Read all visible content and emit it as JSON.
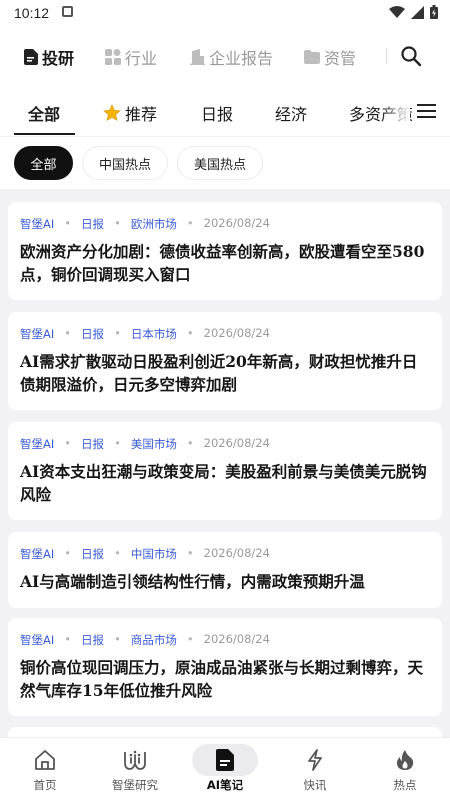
{
  "status_bar": {
    "time": "10:12"
  },
  "top_nav": {
    "items": [
      {
        "label": "投研",
        "icon": "doc-icon",
        "active": true
      },
      {
        "label": "行业",
        "icon": "grid-icon",
        "active": false
      },
      {
        "label": "企业报告",
        "icon": "building-icon",
        "active": false
      },
      {
        "label": "资管",
        "icon": "folder-icon",
        "active": false
      }
    ]
  },
  "category_tabs": [
    {
      "label": "全部",
      "active": true
    },
    {
      "label": "推荐",
      "icon": "star-icon"
    },
    {
      "label": "日报"
    },
    {
      "label": "经济"
    },
    {
      "label": "多资产策"
    }
  ],
  "filter_chips": [
    {
      "label": "全部",
      "active": true
    },
    {
      "label": "中国热点"
    },
    {
      "label": "美国热点"
    }
  ],
  "articles": [
    {
      "source": "智堡AI",
      "type": "日报",
      "market": "欧洲市场",
      "date": "2026/08/24",
      "title": "欧洲资产分化加剧：德债收益率创新高，欧股遭看空至580点，铜价回调现买入窗口"
    },
    {
      "source": "智堡AI",
      "type": "日报",
      "market": "日本市场",
      "date": "2026/08/24",
      "title": "AI需求扩散驱动日股盈利创近20年新高，财政担忧推升日债期限溢价，日元多空博弈加剧"
    },
    {
      "source": "智堡AI",
      "type": "日报",
      "market": "美国市场",
      "date": "2026/08/24",
      "title": "AI资本支出狂潮与政策变局：美股盈利前景与美债美元脱钩风险"
    },
    {
      "source": "智堡AI",
      "type": "日报",
      "market": "中国市场",
      "date": "2026/08/24",
      "title": "AI与高端制造引领结构性行情，内需政策预期升温"
    },
    {
      "source": "智堡AI",
      "type": "日报",
      "market": "商品市场",
      "date": "2026/08/24",
      "title": "铜价高位现回调压力，原油成品油紧张与长期过剩博弈，天然气库存15年低位推升风险"
    }
  ],
  "bottom_nav": [
    {
      "label": "首页",
      "icon": "home-icon"
    },
    {
      "label": "智堡研究",
      "icon": "research-icon"
    },
    {
      "label": "AI笔记",
      "icon": "note-icon",
      "active": true
    },
    {
      "label": "快讯",
      "icon": "flash-icon"
    },
    {
      "label": "热点",
      "icon": "fire-icon"
    }
  ]
}
